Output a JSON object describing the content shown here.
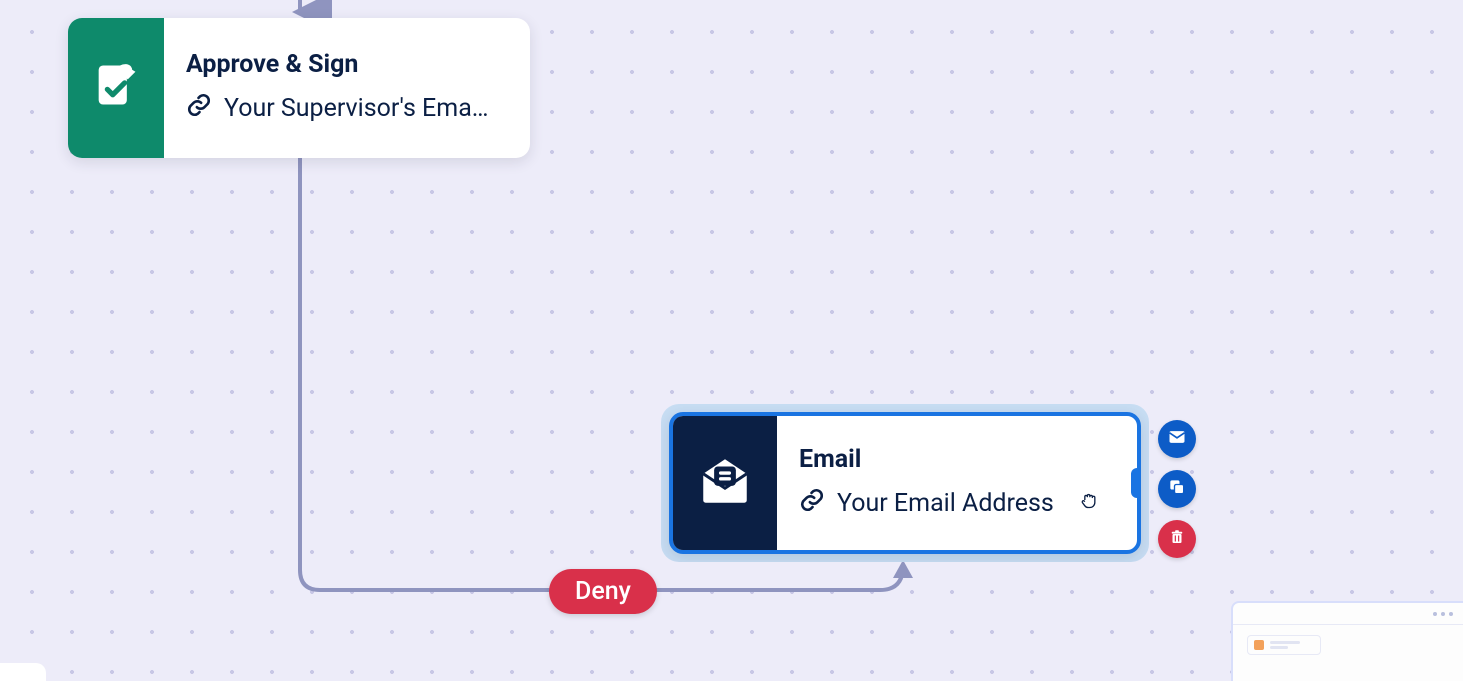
{
  "nodes": {
    "approve": {
      "title": "Approve & Sign",
      "detail": "Your Supervisor's Ema…",
      "icon_name": "document-sign-icon",
      "color": "#0e8a6b"
    },
    "email": {
      "title": "Email",
      "detail": "Your Email Address",
      "icon_name": "envelope-open-icon",
      "color": "#0b1f44",
      "selected": true
    }
  },
  "edges": {
    "deny": {
      "label": "Deny",
      "color": "#d9304a"
    }
  },
  "actions": [
    {
      "name": "email-action",
      "icon": "envelope-icon",
      "color": "blue"
    },
    {
      "name": "copy-action",
      "icon": "copy-icon",
      "color": "blue"
    },
    {
      "name": "delete-action",
      "icon": "trash-icon",
      "color": "red"
    }
  ],
  "colors": {
    "canvas_bg": "#edecf9",
    "selection": "#1a74e2",
    "connector": "#8f94bf"
  }
}
